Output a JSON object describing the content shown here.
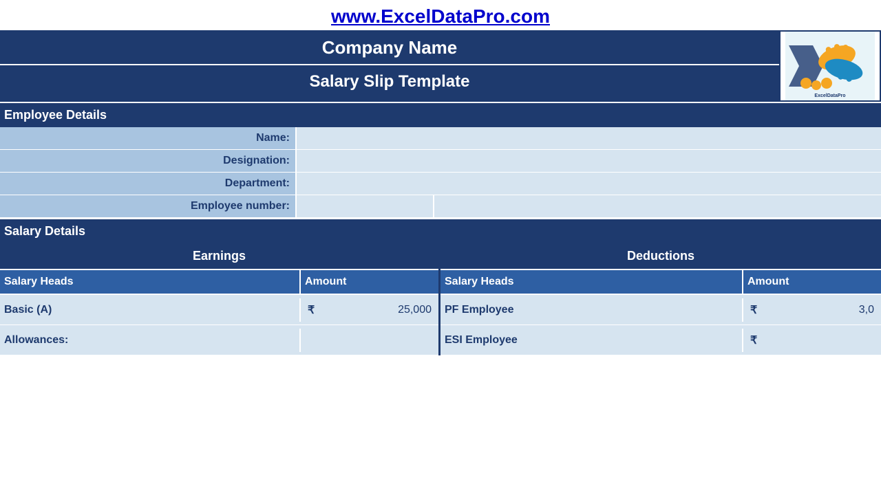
{
  "header": {
    "url": "www.ExcelDataPro.com",
    "url_full": "www.ExcelDataPro.com",
    "company_name": "Company Name",
    "salary_slip_title": "Salary Slip Template"
  },
  "employee_details": {
    "section_label": "Employee Details",
    "fields": [
      {
        "label": "Name:",
        "value": ""
      },
      {
        "label": "Designation:",
        "value": ""
      },
      {
        "label": "Department:",
        "value": ""
      },
      {
        "label": "Employee number:",
        "value1": "",
        "value2": "",
        "split": true
      }
    ]
  },
  "salary_details": {
    "section_label": "Salary Details",
    "earnings": {
      "panel_label": "Earnings",
      "col_salary_heads": "Salary Heads",
      "col_amount": "Amount",
      "rows": [
        {
          "head": "Basic (A)",
          "currency": "₹",
          "amount": "25,000"
        },
        {
          "head": "Allowances:",
          "currency": "",
          "amount": ""
        }
      ]
    },
    "deductions": {
      "panel_label": "Deductions",
      "col_salary_heads": "Salary Heads",
      "col_amount": "Amount",
      "rows": [
        {
          "head": "PF Employee",
          "currency": "₹",
          "amount": "3,0"
        },
        {
          "head": "ESI Employee",
          "currency": "₹",
          "amount": ""
        }
      ]
    }
  },
  "colors": {
    "dark_blue": "#1e3a6e",
    "medium_blue": "#2e5fa3",
    "light_blue": "#d6e4f0",
    "mid_blue": "#a8c4e0",
    "white": "#ffffff"
  }
}
